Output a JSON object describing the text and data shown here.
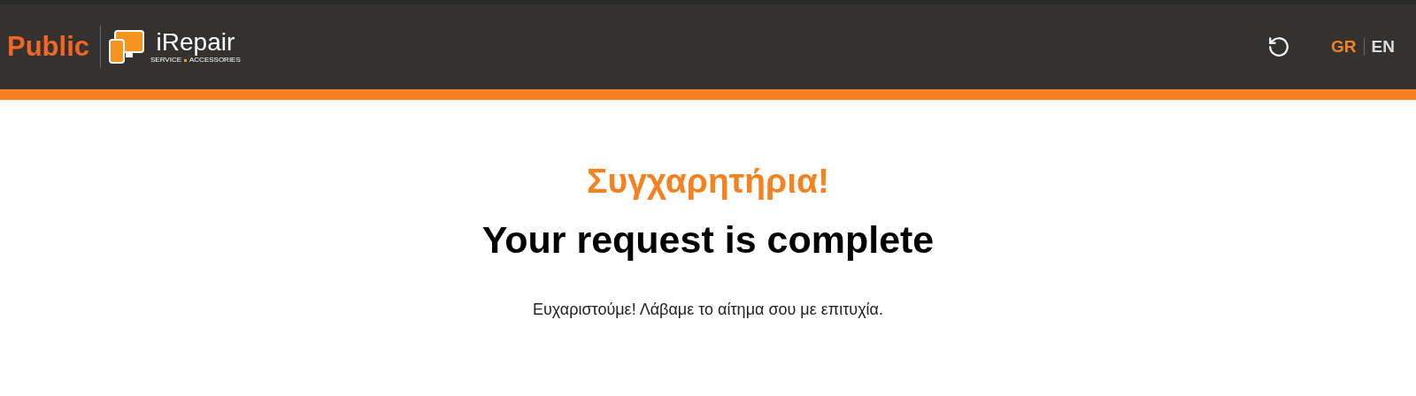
{
  "header": {
    "brand": "Public",
    "logo": {
      "name": "iRepair",
      "tagline_left": "SERVICE",
      "tagline_right": "ACCESSORIES"
    },
    "languages": [
      {
        "label": "GR",
        "selected": true
      },
      {
        "label": "EN",
        "selected": false
      }
    ]
  },
  "content": {
    "title": "Συγχαρητήρια!",
    "heading": "Your request is complete",
    "message": "Ευχαριστούμε! Λάβαμε το αίτημα σου με επιτυχία."
  }
}
